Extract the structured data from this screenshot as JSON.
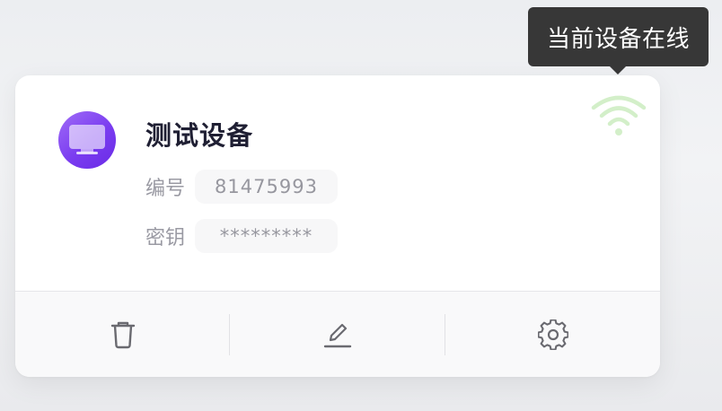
{
  "device": {
    "name": "测试设备",
    "id_label": "编号",
    "id_value": "81475993",
    "key_label": "密钥",
    "key_value": "*********"
  },
  "status": {
    "tooltip": "当前设备在线",
    "icon": "wifi-icon",
    "color": "#cdeec2"
  },
  "actions": [
    {
      "icon": "trash-icon"
    },
    {
      "icon": "edit-icon"
    },
    {
      "icon": "gear-icon"
    }
  ],
  "colors": {
    "avatar_accent": "#7a3cf0",
    "tooltip_bg": "#373737"
  }
}
